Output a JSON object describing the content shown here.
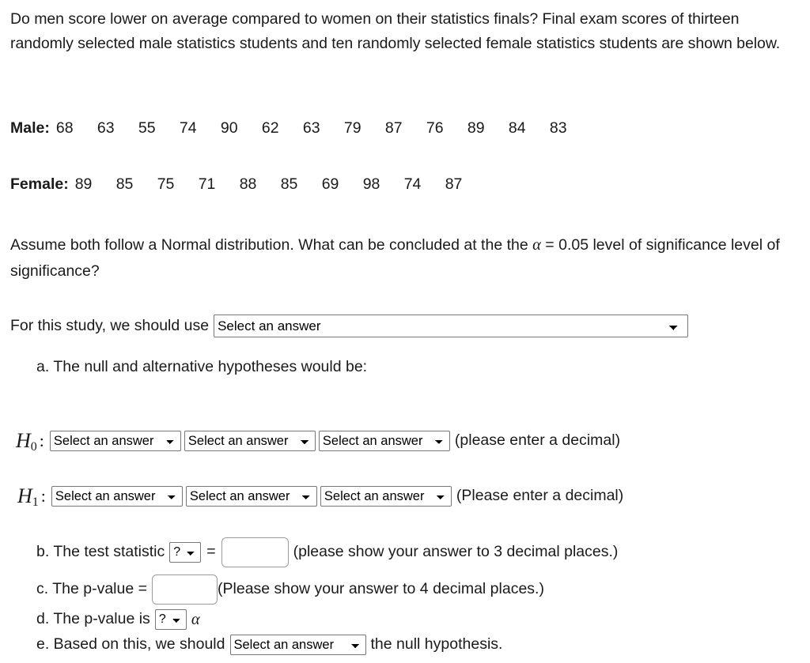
{
  "question": {
    "intro": "Do men score lower on average compared to women on their statistics finals? Final exam scores of thirteen randomly selected male statistics students and ten randomly selected female statistics students are shown below.",
    "male_label": "Male:",
    "male_values": [
      "68",
      "63",
      "55",
      "74",
      "90",
      "62",
      "63",
      "79",
      "87",
      "76",
      "89",
      "84",
      "83"
    ],
    "female_label": "Female:",
    "female_values": [
      "89",
      "85",
      "75",
      "71",
      "88",
      "85",
      "69",
      "98",
      "74",
      "87"
    ],
    "assume_part1": "Assume both follow a Normal distribution.  What can be concluded at the the ",
    "alpha_symbol": "α",
    "assume_part2": " = 0.05 level of significance level of significance?",
    "alpha_level": "0.05"
  },
  "study": {
    "label": "For this study, we should use",
    "select_value": "Select an answer"
  },
  "parts": {
    "a": {
      "text": "a. The null and alternative hypotheses would be:"
    },
    "h0": {
      "symbol": "H",
      "subscript": "0",
      "colon": ":",
      "select1": "Select an answer",
      "select2": "Select an answer",
      "select3": "Select an answer",
      "note": "(please enter a decimal)"
    },
    "h1": {
      "symbol": "H",
      "subscript": "1",
      "colon": ":",
      "select1": "Select an answer",
      "select2": "Select an answer",
      "select3": "Select an answer",
      "note": "(Please enter a decimal)"
    },
    "b": {
      "label": "b. The test statistic",
      "stat_select": "?",
      "equals": "=",
      "input_value": "",
      "note": "(please show your answer to 3 decimal places.)"
    },
    "c": {
      "label": "c. The p-value =",
      "input_value": "",
      "note": "(Please show your answer to 4 decimal places.)"
    },
    "d": {
      "label": "d. The p-value is",
      "compare_select": "?",
      "alpha_symbol": "α"
    },
    "e": {
      "label_before": "e. Based on this, we should",
      "decision_select": "Select an answer",
      "label_after": "the null hypothesis."
    }
  },
  "select_options": [
    "Select an answer"
  ],
  "tiny_options": [
    "?"
  ],
  "colors": {
    "text": "#1a1a1a",
    "control_border": "#767676",
    "input_border": "#9a9a9a",
    "background": "#ffffff"
  }
}
